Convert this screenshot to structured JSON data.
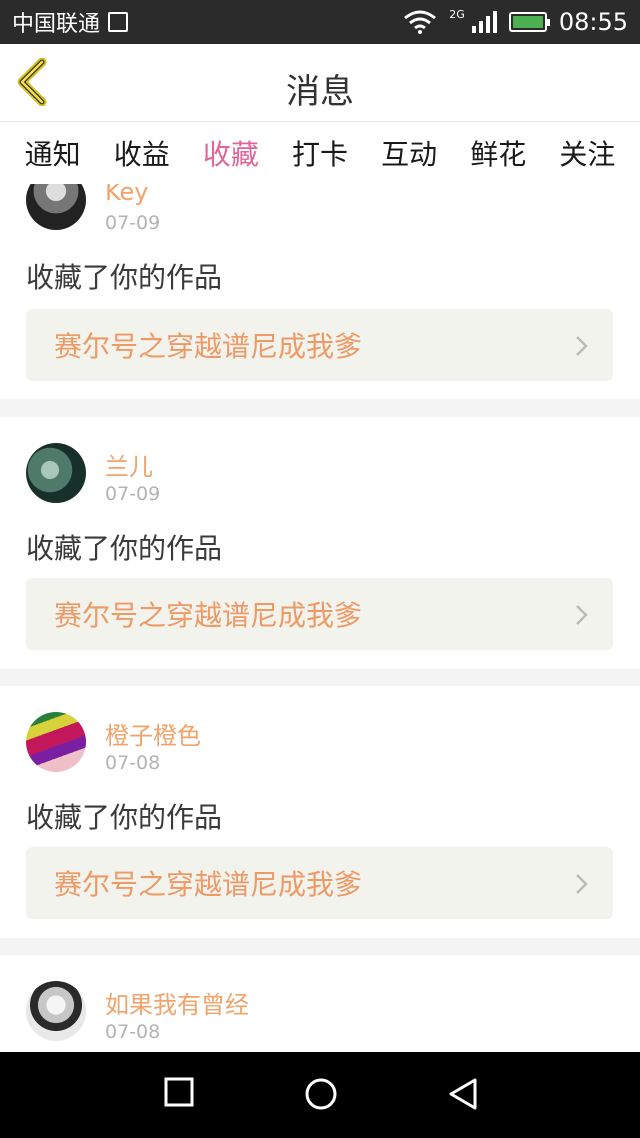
{
  "status_bar": {
    "carrier": "中国联通",
    "network": "2G",
    "time": "08:55"
  },
  "header": {
    "title": "消息"
  },
  "tabs": [
    {
      "label": "通知"
    },
    {
      "label": "收益"
    },
    {
      "label": "收藏",
      "active": true
    },
    {
      "label": "打卡"
    },
    {
      "label": "互动"
    },
    {
      "label": "鲜花"
    },
    {
      "label": "关注"
    }
  ],
  "messages": [
    {
      "user": "Key",
      "date": "07-09",
      "action": "收藏了你的作品",
      "work": "赛尔号之穿越谱尼成我爹"
    },
    {
      "user": "兰儿",
      "date": "07-09",
      "action": "收藏了你的作品",
      "work": "赛尔号之穿越谱尼成我爹"
    },
    {
      "user": "橙子橙色",
      "date": "07-08",
      "action": "收藏了你的作品",
      "work": "赛尔号之穿越谱尼成我爹"
    },
    {
      "user": "如果我有曾经",
      "date": "07-08"
    }
  ],
  "colors": {
    "accent": "#e0669a",
    "username": "#f0a46b",
    "work_title": "#ee9a66"
  }
}
